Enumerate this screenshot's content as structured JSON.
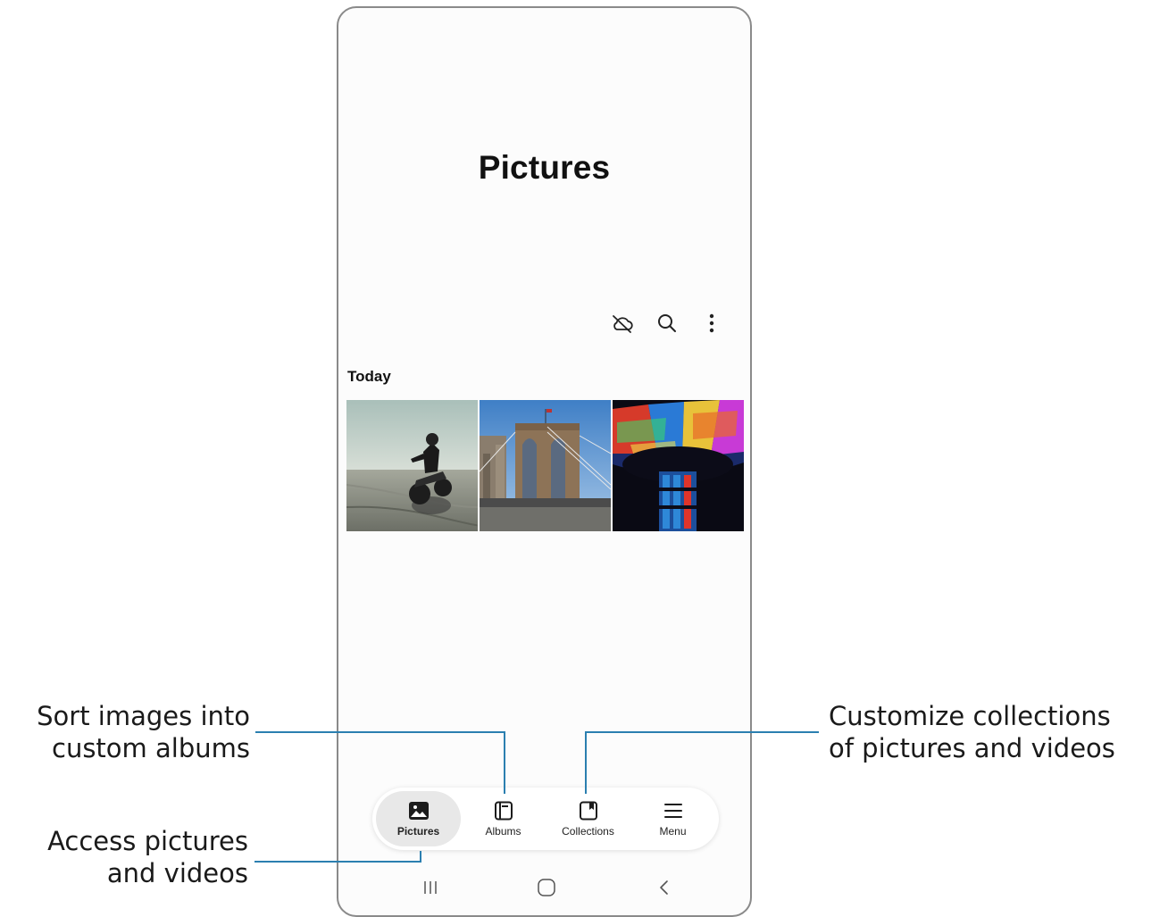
{
  "screen": {
    "title": "Pictures",
    "section_header": "Today",
    "action_icons": [
      "cloud-off-icon",
      "search-icon",
      "more-options-icon"
    ]
  },
  "bottom_nav": {
    "items": [
      {
        "label": "Pictures",
        "icon": "pictures-icon",
        "active": true
      },
      {
        "label": "Albums",
        "icon": "albums-icon",
        "active": false
      },
      {
        "label": "Collections",
        "icon": "collections-icon",
        "active": false
      },
      {
        "label": "Menu",
        "icon": "menu-icon",
        "active": false
      }
    ]
  },
  "thumbnails": [
    {
      "subject": "motorcycle-rider"
    },
    {
      "subject": "brooklyn-bridge"
    },
    {
      "subject": "stained-glass-dome"
    }
  ],
  "system_nav": [
    "recent-apps-icon",
    "home-icon",
    "back-icon"
  ],
  "callouts": {
    "albums": {
      "line1": "Sort images into",
      "line2": "custom albums"
    },
    "pictures": {
      "line1": "Access pictures",
      "line2": "and videos"
    },
    "collections": {
      "line1": "Customize collections",
      "line2": "of pictures and videos"
    }
  },
  "colors": {
    "callout_line": "#2b7fb0",
    "active_nav_bg": "#e8e8e8"
  }
}
